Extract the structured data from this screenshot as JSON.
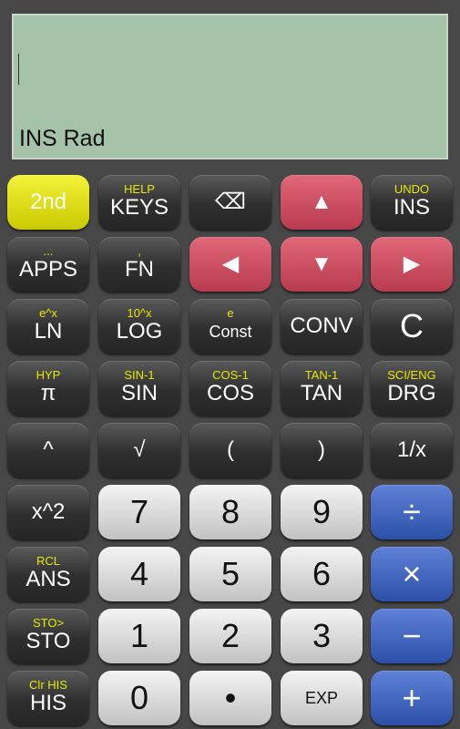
{
  "display": {
    "status": "INS Rad",
    "input": ""
  },
  "colors": {
    "display_bg": "#a4c3a8",
    "secondary_label": "#e8e800",
    "yellow_key": "#e0e01a",
    "red_key": "#c84c5e",
    "blue_key": "#3c5fb8"
  },
  "keys": [
    {
      "main": "2nd",
      "sub": "",
      "style": "yellow",
      "name": "2nd-button"
    },
    {
      "main": "KEYS",
      "sub": "HELP",
      "style": "dark",
      "name": "keys-button"
    },
    {
      "main": "⌫",
      "sub": "",
      "style": "dark",
      "name": "backspace-button",
      "icon": "backspace-icon"
    },
    {
      "main": "▲",
      "sub": "",
      "style": "red",
      "name": "up-arrow-button",
      "icon": "arrow-up-icon"
    },
    {
      "main": "INS",
      "sub": "UNDO",
      "style": "dark",
      "name": "ins-button"
    },
    {
      "main": "APPS",
      "sub": "...",
      "style": "dark",
      "name": "apps-button"
    },
    {
      "main": "FN",
      "sub": ",",
      "style": "dark",
      "name": "fn-button"
    },
    {
      "main": "◀",
      "sub": "",
      "style": "red",
      "name": "left-arrow-button",
      "icon": "arrow-left-icon"
    },
    {
      "main": "▼",
      "sub": "",
      "style": "red",
      "name": "down-arrow-button",
      "icon": "arrow-down-icon"
    },
    {
      "main": "▶",
      "sub": "",
      "style": "red",
      "name": "right-arrow-button",
      "icon": "arrow-right-icon"
    },
    {
      "main": "LN",
      "sub": "e^x",
      "style": "dark",
      "name": "ln-button"
    },
    {
      "main": "LOG",
      "sub": "10^x",
      "style": "dark",
      "name": "log-button"
    },
    {
      "main": "Const",
      "sub": "e",
      "style": "dark small",
      "name": "const-button"
    },
    {
      "main": "CONV",
      "sub": "",
      "style": "dark",
      "name": "conv-button"
    },
    {
      "main": "C",
      "sub": "",
      "style": "dark big",
      "name": "clear-button"
    },
    {
      "main": "π",
      "sub": "HYP",
      "style": "dark",
      "name": "pi-button"
    },
    {
      "main": "SIN",
      "sub": "SIN-1",
      "style": "dark",
      "name": "sin-button"
    },
    {
      "main": "COS",
      "sub": "COS-1",
      "style": "dark",
      "name": "cos-button"
    },
    {
      "main": "TAN",
      "sub": "TAN-1",
      "style": "dark",
      "name": "tan-button"
    },
    {
      "main": "DRG",
      "sub": "SCI/ENG",
      "style": "dark",
      "name": "drg-button"
    },
    {
      "main": "^",
      "sub": "",
      "style": "dark",
      "name": "power-button"
    },
    {
      "main": "√",
      "sub": "",
      "style": "dark",
      "name": "sqrt-button"
    },
    {
      "main": "(",
      "sub": "",
      "style": "dark",
      "name": "open-paren-button"
    },
    {
      "main": ")",
      "sub": "",
      "style": "dark",
      "name": "close-paren-button"
    },
    {
      "main": "1/x",
      "sub": "",
      "style": "dark",
      "name": "reciprocal-button"
    },
    {
      "main": "x^2",
      "sub": "",
      "style": "dark",
      "name": "square-button"
    },
    {
      "main": "7",
      "sub": "",
      "style": "light",
      "name": "digit-7-button"
    },
    {
      "main": "8",
      "sub": "",
      "style": "light",
      "name": "digit-8-button"
    },
    {
      "main": "9",
      "sub": "",
      "style": "light",
      "name": "digit-9-button"
    },
    {
      "main": "÷",
      "sub": "",
      "style": "blue big",
      "name": "divide-button"
    },
    {
      "main": "ANS",
      "sub": "RCL",
      "style": "dark",
      "name": "ans-button"
    },
    {
      "main": "4",
      "sub": "",
      "style": "light",
      "name": "digit-4-button"
    },
    {
      "main": "5",
      "sub": "",
      "style": "light",
      "name": "digit-5-button"
    },
    {
      "main": "6",
      "sub": "",
      "style": "light",
      "name": "digit-6-button"
    },
    {
      "main": "×",
      "sub": "",
      "style": "blue big",
      "name": "multiply-button"
    },
    {
      "main": "STO",
      "sub": "STO>",
      "style": "dark",
      "name": "sto-button"
    },
    {
      "main": "1",
      "sub": "",
      "style": "light",
      "name": "digit-1-button"
    },
    {
      "main": "2",
      "sub": "",
      "style": "light",
      "name": "digit-2-button"
    },
    {
      "main": "3",
      "sub": "",
      "style": "light",
      "name": "digit-3-button"
    },
    {
      "main": "−",
      "sub": "",
      "style": "blue big",
      "name": "subtract-button"
    },
    {
      "main": "HIS",
      "sub": "Clr HIS",
      "style": "dark",
      "name": "his-button"
    },
    {
      "main": "0",
      "sub": "",
      "style": "light",
      "name": "digit-0-button"
    },
    {
      "main": "•",
      "sub": "",
      "style": "light",
      "name": "decimal-point-button"
    },
    {
      "main": "EXP",
      "sub": "",
      "style": "light small",
      "name": "exp-button"
    },
    {
      "main": "+",
      "sub": "",
      "style": "blue big",
      "name": "add-button"
    }
  ]
}
